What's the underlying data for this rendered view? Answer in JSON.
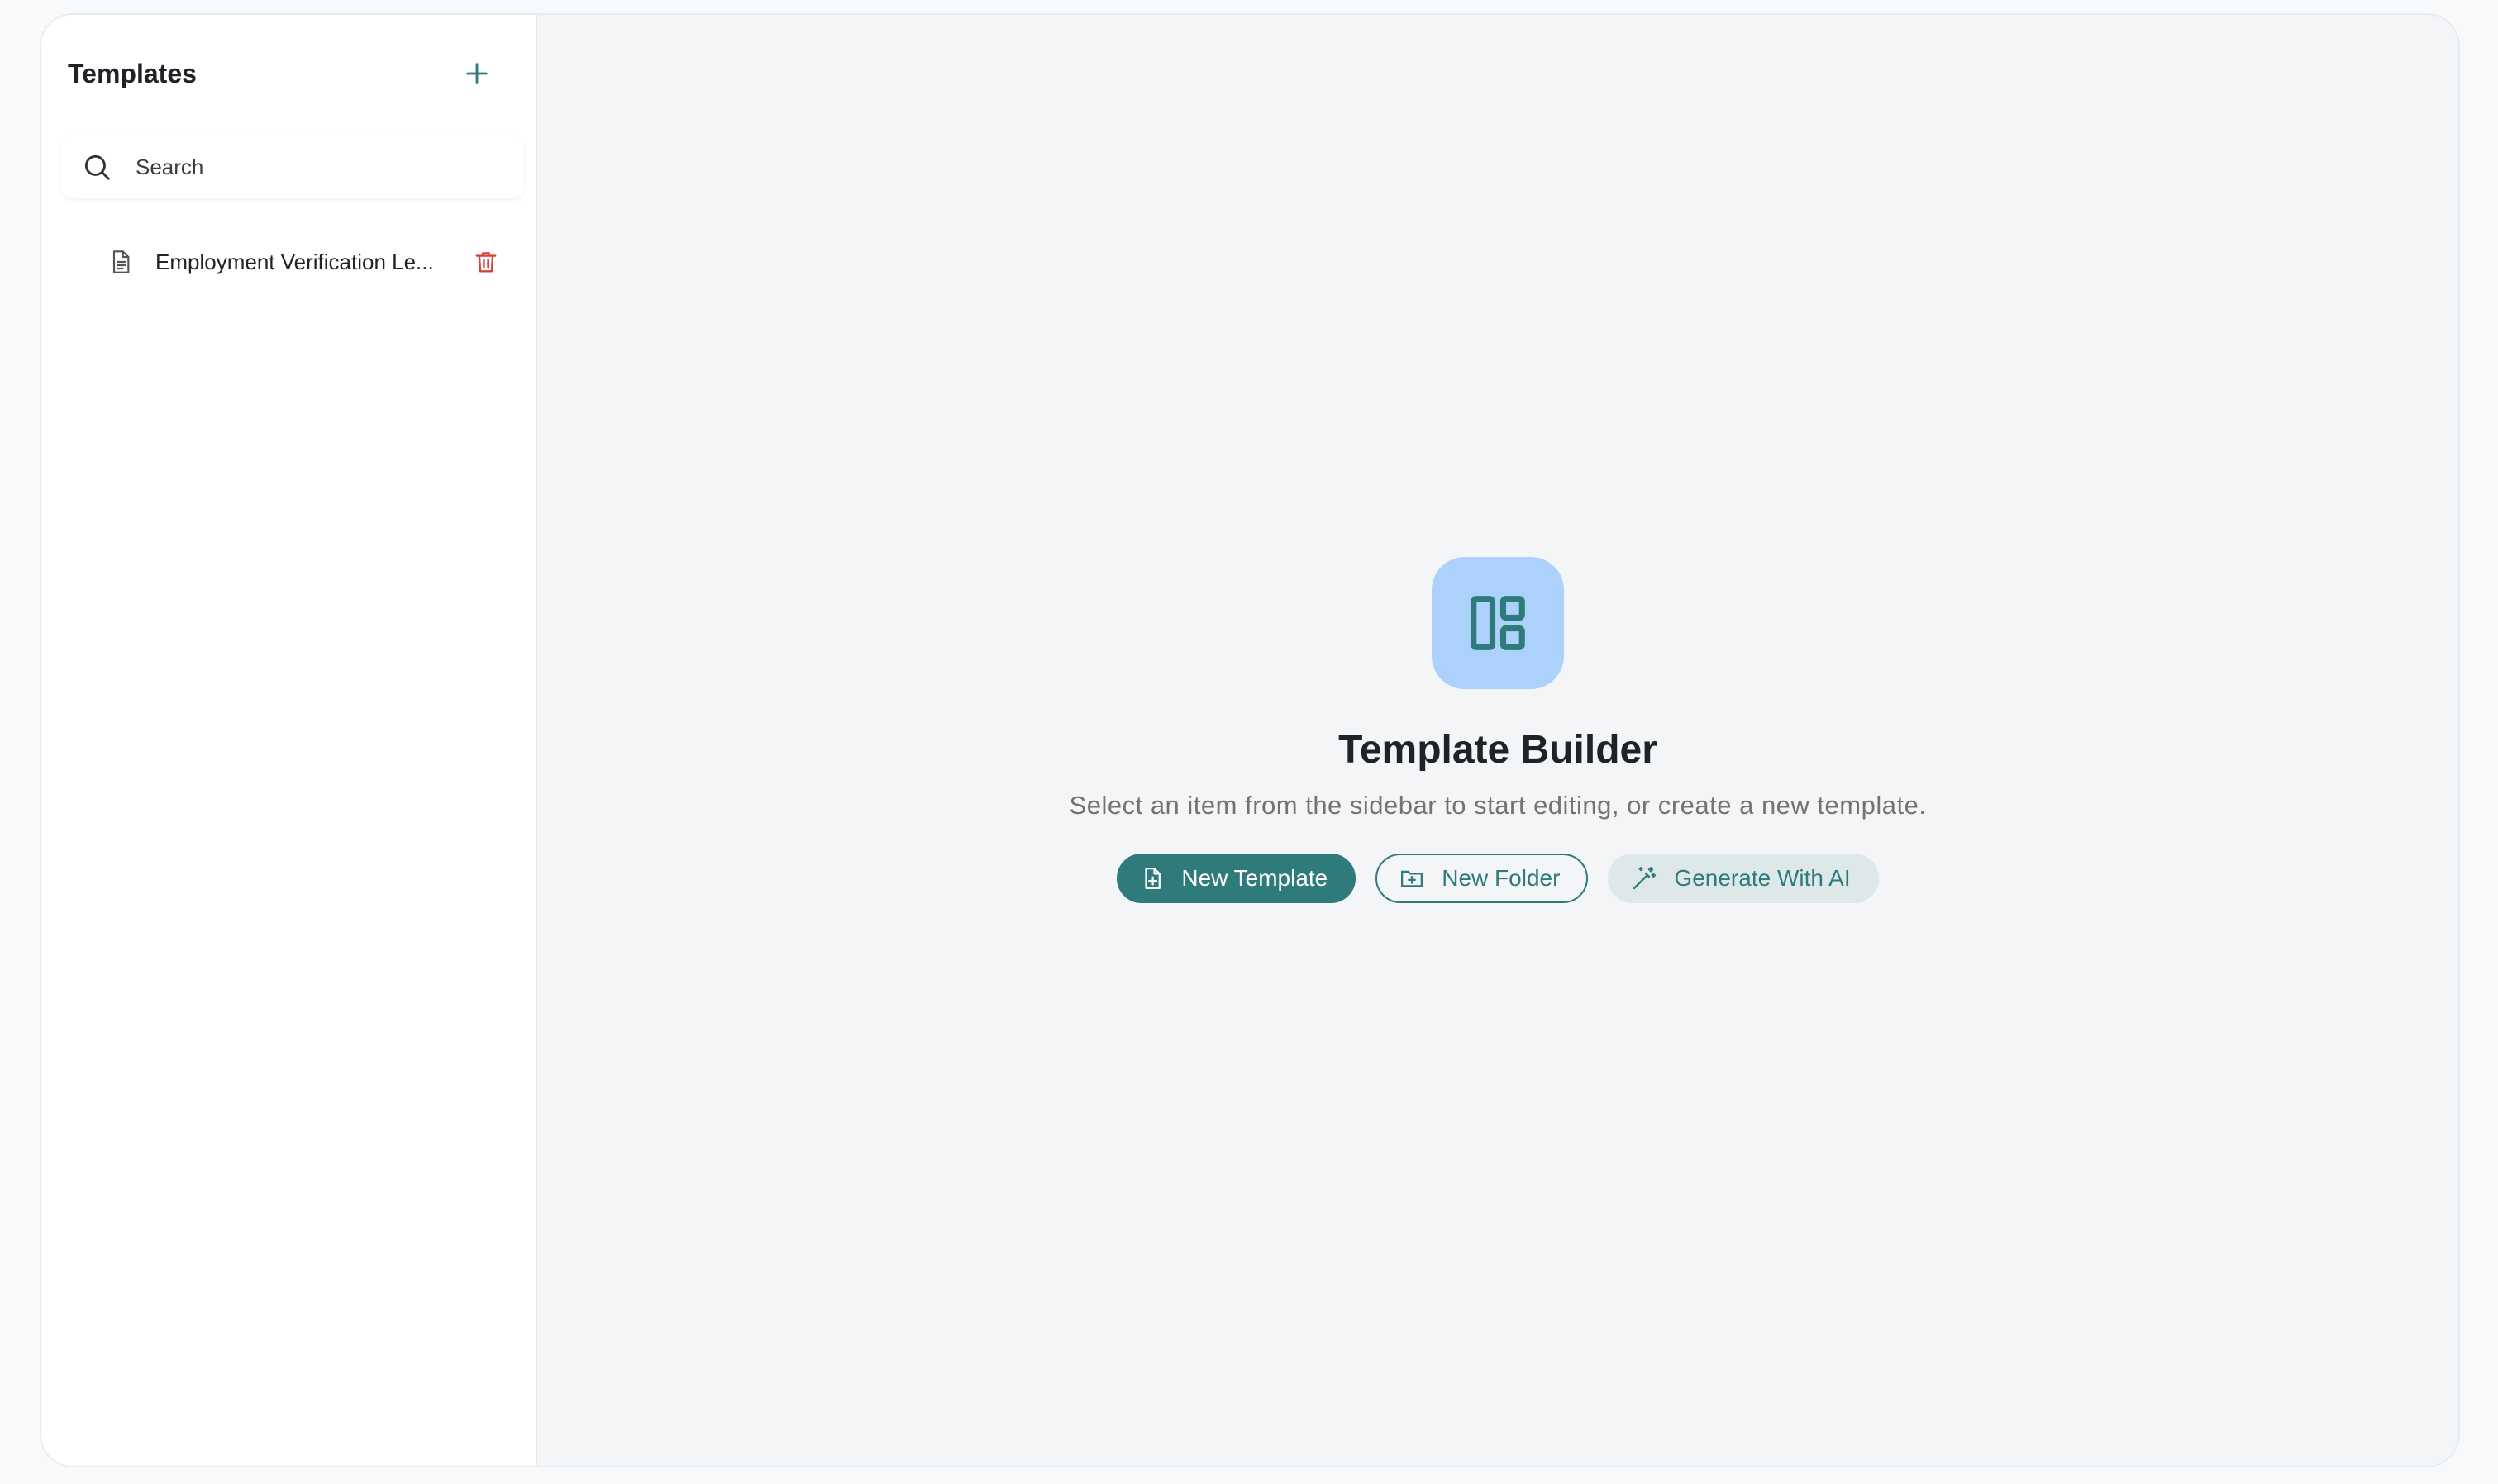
{
  "sidebar": {
    "title": "Templates",
    "add_icon": "plus-icon",
    "search": {
      "placeholder": "Search",
      "value": "",
      "icon": "search-icon"
    },
    "items": [
      {
        "label": "Employment Verification Le...",
        "icon": "file-text-icon",
        "delete_icon": "trash-icon"
      }
    ]
  },
  "main": {
    "hero_icon": "layout-icon",
    "title": "Template Builder",
    "subtitle": "Select an item from the sidebar to start editing, or create a new template.",
    "actions": {
      "new_template": "New Template",
      "new_folder": "New Folder",
      "generate_ai": "Generate With AI"
    }
  },
  "colors": {
    "accent": "#2f7b7c",
    "hero_bg": "#acd2fc",
    "danger": "#d9423a",
    "soft_button_bg": "#dfe8e8"
  }
}
